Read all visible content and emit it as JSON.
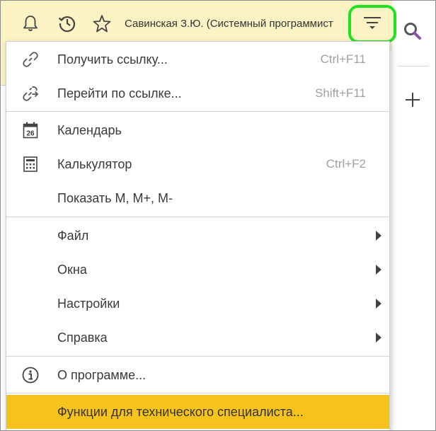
{
  "topbar": {
    "user_title": "Савинская З.Ю. (Системный программист",
    "icons": [
      "bell-icon",
      "history-icon",
      "star-icon",
      "menu-icon"
    ]
  },
  "sidebar_right": {
    "icons": [
      "search-icon",
      "plus-icon"
    ]
  },
  "menu": {
    "items": [
      {
        "label": "Получить ссылку...",
        "shortcut": "Ctrl+F11",
        "icon": "link-icon"
      },
      {
        "label": "Перейти по ссылке...",
        "shortcut": "Shift+F11",
        "icon": "link-go-icon"
      },
      {
        "label": "Календарь",
        "shortcut": "",
        "icon": "calendar-icon",
        "icon_text": "26"
      },
      {
        "label": "Калькулятор",
        "shortcut": "Ctrl+F2",
        "icon": "calculator-icon"
      },
      {
        "label": "Показать М, М+, М-",
        "shortcut": ""
      },
      {
        "label": "Файл",
        "submenu": true
      },
      {
        "label": "Окна",
        "submenu": true
      },
      {
        "label": "Настройки",
        "submenu": true
      },
      {
        "label": "Справка",
        "submenu": true
      },
      {
        "label": "О программе...",
        "icon": "info-icon"
      },
      {
        "label": "Функции для технического специалиста...",
        "highlighted": true
      }
    ]
  },
  "colors": {
    "topbar_bg": "#fbf3c4",
    "highlight": "#f5c31c",
    "focus_ring": "#22e022",
    "search_accent": "#8e4fa8"
  }
}
